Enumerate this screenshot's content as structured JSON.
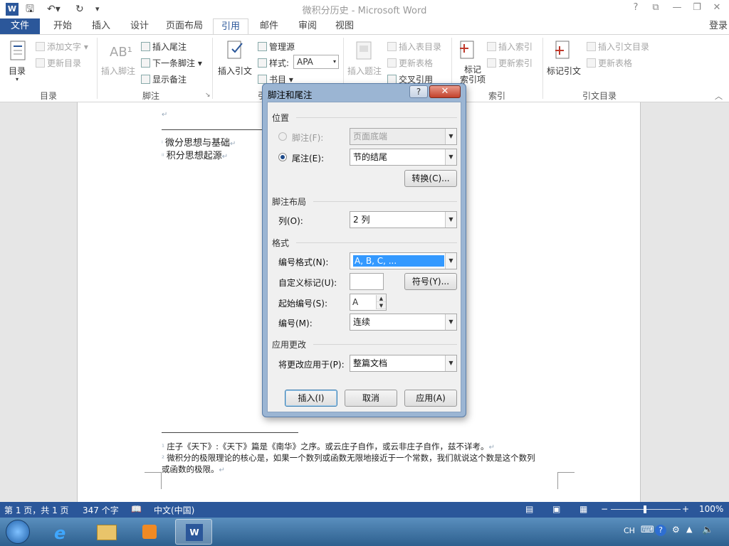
{
  "titlebar": {
    "app_icon": "W",
    "title": "微积分历史 - Microsoft Word",
    "quick_access": [
      "save-icon",
      "undo-icon",
      "redo-icon",
      "customize-icon"
    ],
    "controls": [
      "?",
      "⧉",
      "—",
      "❐",
      "✕"
    ]
  },
  "tabs": {
    "file": "文件",
    "items": [
      "开始",
      "插入",
      "设计",
      "页面布局",
      "引用",
      "邮件",
      "审阅",
      "视图"
    ],
    "active": "引用",
    "login": "登录"
  },
  "ribbon": {
    "toc": {
      "big": "目录",
      "add_text": "添加文字",
      "update": "更新目录",
      "group": "目录"
    },
    "footnotes": {
      "insert_footnote": "插入脚注",
      "ab_big": "AB¹",
      "insert_endnote": "插入尾注",
      "next_footnote": "下一条脚注",
      "show_notes": "显示备注",
      "group": "脚注"
    },
    "citations": {
      "insert_citation": "插入引文",
      "manage_sources": "管理源",
      "style_label": "样式:",
      "style_value": "APA",
      "bibliography": "书目",
      "group": "引"
    },
    "captions": {
      "insert_caption": "插入题注",
      "insert_tof": "插入表目录",
      "update_table": "更新表格",
      "cross_ref": "交叉引用"
    },
    "index": {
      "mark_entry": "标记\n索引项",
      "insert_index": "插入索引",
      "update_index": "更新索引",
      "group": "索引"
    },
    "toa": {
      "mark_citation": "标记引文",
      "insert_toa": "插入引文目录",
      "update_table": "更新表格",
      "group": "引文目录"
    }
  },
  "document": {
    "cursor_mark": "↵",
    "lines": [
      "微分思想与基础",
      "积分思想起源"
    ],
    "footnotes": [
      "庄子《天下》:《天下》篇是《南华》之序。或云庄子自作，或云非庄子自作，兹不详考。",
      "微积分的极限理论的核心是，如果一个数列或函数无限地接近于一个常数，我们就说这个数是这个数列",
      "或函数的极限。"
    ]
  },
  "dialog": {
    "title": "脚注和尾注",
    "help": "?",
    "close": "✕",
    "position_section": "位置",
    "footnote_label": "脚注(F):",
    "footnote_value": "页面底端",
    "endnote_label": "尾注(E):",
    "endnote_value": "节的结尾",
    "convert_button": "转换(C)...",
    "layout_section": "脚注布局",
    "columns_label": "列(O):",
    "columns_value": "2 列",
    "format_section": "格式",
    "number_format_label": "编号格式(N):",
    "number_format_value": "A, B, C, ...",
    "custom_mark_label": "自定义标记(U):",
    "custom_mark_value": "",
    "symbol_button": "符号(Y)...",
    "start_at_label": "起始编号(S):",
    "start_at_value": "A",
    "numbering_label": "编号(M):",
    "numbering_value": "连续",
    "apply_section": "应用更改",
    "apply_to_label": "将更改应用于(P):",
    "apply_to_value": "整篇文档",
    "insert_button": "插入(I)",
    "cancel_button": "取消",
    "apply_button": "应用(A)"
  },
  "statusbar": {
    "page": "第 1 页，共 1 页",
    "words": "347 个字",
    "language": "中文(中国)",
    "zoom": "100%"
  },
  "taskbar": {
    "tray_lang": "CH",
    "items": [
      "start-orb-icon",
      "ie-icon",
      "explorer-icon",
      "media-player-icon",
      "word-icon"
    ]
  },
  "colors": {
    "accent": "#2b579a",
    "selection": "#3399ff",
    "dialog_frame": "#9bb5d3"
  }
}
